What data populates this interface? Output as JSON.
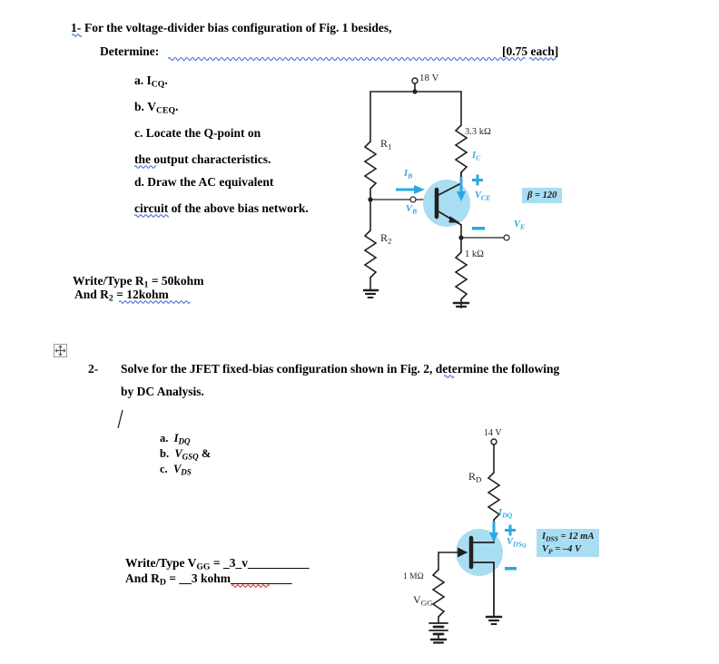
{
  "document": {
    "problem1": {
      "number": "1-",
      "title": "For the voltage-divider bias configuration of Fig. 1 besides,",
      "determine_label": "Determine:",
      "marks": "[0.75 each]",
      "items": [
        {
          "key": "a.",
          "text": "I",
          "sub": "CQ",
          "tail": "."
        },
        {
          "key": "b.",
          "text": "V",
          "sub": "CEQ",
          "tail": "."
        },
        {
          "key": "c.",
          "text": "Locate the Q-point on",
          "sub": "",
          "tail": ""
        },
        {
          "key": "",
          "text": "the output characteristics.",
          "sub": "",
          "tail": ""
        },
        {
          "key": "d.",
          "text": "Draw the AC equivalent",
          "sub": "",
          "tail": ""
        },
        {
          "key": "",
          "text": "circuit of the above bias network.",
          "sub": "",
          "tail": ""
        }
      ],
      "answer_line1_prefix": "Write/Type R",
      "answer_line1_sub": "1",
      "answer_line1_value": " = 50kohm",
      "answer_line2_prefix": "And R",
      "answer_line2_sub": "2",
      "answer_line2_value": " = 12kohm"
    },
    "problem2": {
      "number": "2-",
      "line1": "Solve for the JFET fixed-bias configuration shown in Fig. 2, determine the following",
      "line2": "by DC Analysis.",
      "items": [
        {
          "key": "a.",
          "main": "I",
          "sub": "DQ",
          "tail": ""
        },
        {
          "key": "b.",
          "main": "V",
          "sub": "GSQ",
          "tail": " &"
        },
        {
          "key": "c.",
          "main": "V",
          "sub": "DS",
          "tail": ""
        }
      ],
      "answer_line1_prefix": "Write/Type V",
      "answer_line1_sub": "GG",
      "answer_line1_value": " =  _3_v__________",
      "answer_line2_prefix": "And R",
      "answer_line2_sub": "D",
      "answer_line2_value": " =  __3 kohm__________"
    }
  },
  "figure1": {
    "name": "voltage-divider-bias-bjt-circuit",
    "supply_label": "18 V",
    "r1_label": "R",
    "r1_sub": "1",
    "r2_label": "R",
    "r2_sub": "2",
    "rc_label": "3.3 kΩ",
    "re_label": "1 kΩ",
    "ic_label": "I",
    "ic_sub": "C",
    "ib_label": "I",
    "ib_sub": "B",
    "vb_label": "V",
    "vb_sub": "B",
    "vce_label": "V",
    "vce_sub": "CE",
    "ve_label": "V",
    "ve_sub": "E",
    "plus_sign": "+",
    "minus_sign": "–",
    "beta_box": "β = 120",
    "accent_color": "#2aa9e0",
    "device_fill": "#a9ddf2",
    "wire_color": "#231f20"
  },
  "figure2": {
    "name": "jfet-fixed-bias-circuit",
    "supply_label": "14 V",
    "rd_label": "R",
    "rd_sub": "D",
    "rg_label": "1 MΩ",
    "vgg_label": "V",
    "vgg_sub": "GG",
    "idq_label": "I",
    "idq_sub": "DQ",
    "vdsq_label": "V",
    "vdsq_sub": "DS",
    "vdsq_sub2": "Q",
    "plus_sign": "+",
    "minus_sign": "–",
    "battery_minus": "–",
    "battery_plus": "+",
    "info_line1": "I",
    "info_line1_sub": "DSS",
    "info_line1_val": " = 12 mA",
    "info_line2": "V",
    "info_line2_sub": "P",
    "info_line2_val": " = –4 V",
    "accent_color": "#2aa9e0",
    "device_fill": "#a9ddf2",
    "wire_color": "#231f20"
  },
  "ui": {
    "move_handle_icon": "move-cross-icon"
  }
}
